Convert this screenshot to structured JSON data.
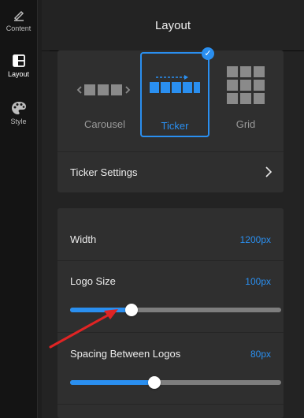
{
  "sidebar": {
    "items": [
      {
        "label": "Content",
        "icon": "pencil-icon"
      },
      {
        "label": "Layout",
        "icon": "layout-icon"
      },
      {
        "label": "Style",
        "icon": "palette-icon"
      }
    ],
    "active": "Layout"
  },
  "header": {
    "title": "Layout"
  },
  "layout_options": {
    "items": [
      {
        "label": "Carousel",
        "icon": "carousel-icon"
      },
      {
        "label": "Ticker",
        "icon": "ticker-icon"
      },
      {
        "label": "Grid",
        "icon": "grid-icon"
      }
    ],
    "selected": "Ticker"
  },
  "ticker_settings": {
    "label": "Ticker Settings"
  },
  "settings": {
    "width": {
      "label": "Width",
      "value": "1200px"
    },
    "logo_size": {
      "label": "Logo Size",
      "value": "100px",
      "slider_fraction": 0.29
    },
    "spacing": {
      "label": "Spacing Between Logos",
      "value": "80px",
      "slider_fraction": 0.4
    }
  },
  "colors": {
    "accent": "#2a8ff0",
    "annotation_arrow": "#e02424"
  }
}
